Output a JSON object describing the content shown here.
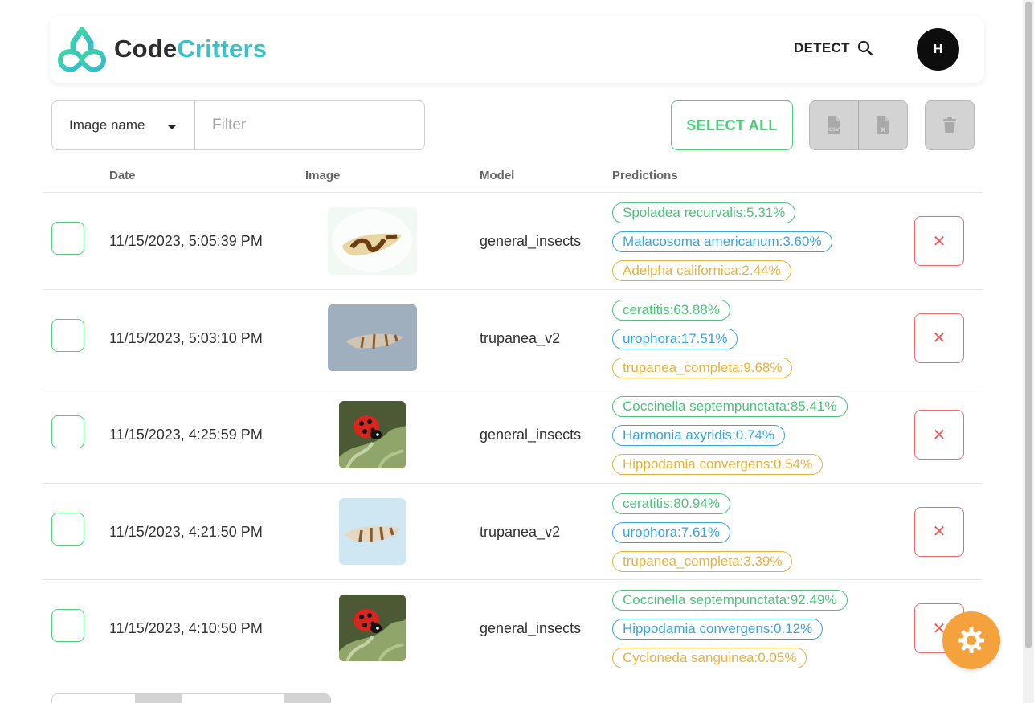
{
  "header": {
    "brand_code": "Code",
    "brand_critters": "Critters",
    "detect_label": "DETECT",
    "avatar_initial": "H"
  },
  "toolbar": {
    "filter_field": "Image name",
    "filter_placeholder": "Filter",
    "select_all_label": "SELECT ALL",
    "export_csv_icon": "csv-file-icon",
    "export_excel_icon": "excel-file-icon",
    "delete_icon": "trash-icon"
  },
  "table": {
    "headers": {
      "date": "Date",
      "image": "Image",
      "model": "Model",
      "predictions": "Predictions"
    },
    "rows": [
      {
        "date": "11/15/2023, 5:05:39 PM",
        "image": "moth-wing",
        "model": "general_insects",
        "predictions": [
          "Spoladea recurvalis:5.31%",
          "Malacosoma americanum:3.60%",
          "Adelpha californica:2.44%"
        ]
      },
      {
        "date": "11/15/2023, 5:03:10 PM",
        "image": "fly-wing-gray",
        "model": "trupanea_v2",
        "predictions": [
          "ceratitis:63.88%",
          "urophora:17.51%",
          "trupanea_completa:9.68%"
        ]
      },
      {
        "date": "11/15/2023, 4:25:59 PM",
        "image": "ladybug",
        "model": "general_insects",
        "predictions": [
          "Coccinella septempunctata:85.41%",
          "Harmonia axyridis:0.74%",
          "Hippodamia convergens:0.54%"
        ]
      },
      {
        "date": "11/15/2023, 4:21:50 PM",
        "image": "fly-wing-blue",
        "model": "trupanea_v2",
        "predictions": [
          "ceratitis:80.94%",
          "urophora:7.61%",
          "trupanea_completa:3.39%"
        ]
      },
      {
        "date": "11/15/2023, 4:10:50 PM",
        "image": "ladybug",
        "model": "general_insects",
        "predictions": [
          "Coccinella septempunctata:92.49%",
          "Hippodamia convergens:0.12%",
          "Cycloneda sanguinea:0.05%"
        ]
      }
    ],
    "delete_row_glyph": "✕"
  },
  "colors": {
    "accent_green": "#4cd07a",
    "pred_top": "#4cc37a",
    "pred_second": "#3aa5de",
    "pred_third": "#e8b23a",
    "danger": "#ee5a5a",
    "fab": "#f6a23c",
    "brand_teal": "#3cc1c9"
  },
  "fab_icon": "gear-icon"
}
